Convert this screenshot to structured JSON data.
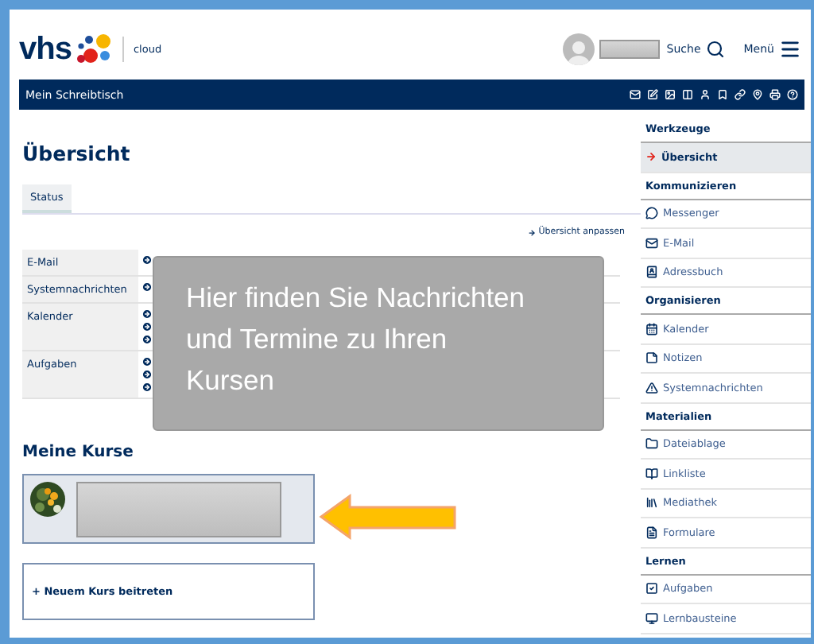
{
  "header": {
    "logo_text": "vhs",
    "logo_subtitle": "cloud",
    "search_label": "Suche",
    "menu_label": "Menü"
  },
  "navbar": {
    "title": "Mein Schreibtisch"
  },
  "overview": {
    "title": "Übersicht",
    "tabs": [
      {
        "label": "Status",
        "selected": true
      }
    ],
    "customize_link": "Übersicht anpassen",
    "rows": [
      {
        "label": "E-Mail",
        "entries": [
          {
            "kind": "arrow"
          }
        ]
      },
      {
        "label": "Systemnachrichten",
        "entries": [
          {
            "kind": "arrow"
          }
        ]
      },
      {
        "label": "Kalender",
        "entries": [
          {
            "kind": "arrow"
          },
          {
            "kind": "arrow"
          },
          {
            "kind": "arrow"
          }
        ]
      },
      {
        "label": "Aufgaben",
        "entries": [
          {
            "kind": "arrow"
          },
          {
            "kind": "arrow"
          },
          {
            "kind": "arrow"
          }
        ]
      }
    ]
  },
  "callout": {
    "text": "Hier finden Sie Nachrichten und Termine zu Ihren Kursen"
  },
  "courses": {
    "title": "Meine Kurse",
    "cards": [
      {
        "kind": "course"
      }
    ],
    "join_label": "+ Neuem Kurs beitreten"
  },
  "sidebar": {
    "sections": [
      {
        "title": "Werkzeuge",
        "items": [
          {
            "label": "Übersicht",
            "selected": true
          }
        ]
      },
      {
        "title": "Kommunizieren",
        "items": [
          {
            "label": "Messenger",
            "selected": false
          },
          {
            "label": "E-Mail",
            "selected": false
          },
          {
            "label": "Adressbuch",
            "selected": false
          }
        ]
      },
      {
        "title": "Organisieren",
        "items": [
          {
            "label": "Kalender",
            "selected": false
          },
          {
            "label": "Notizen",
            "selected": false
          },
          {
            "label": "Systemnachrichten",
            "selected": false
          }
        ]
      },
      {
        "title": "Materialien",
        "items": [
          {
            "label": "Dateiablage",
            "selected": false
          },
          {
            "label": "Linkliste",
            "selected": false
          },
          {
            "label": "Mediathek",
            "selected": false
          },
          {
            "label": "Formulare",
            "selected": false
          }
        ]
      },
      {
        "title": "Lernen",
        "items": [
          {
            "label": "Aufgaben",
            "selected": false
          },
          {
            "label": "Lernbausteine",
            "selected": false
          }
        ]
      }
    ]
  }
}
